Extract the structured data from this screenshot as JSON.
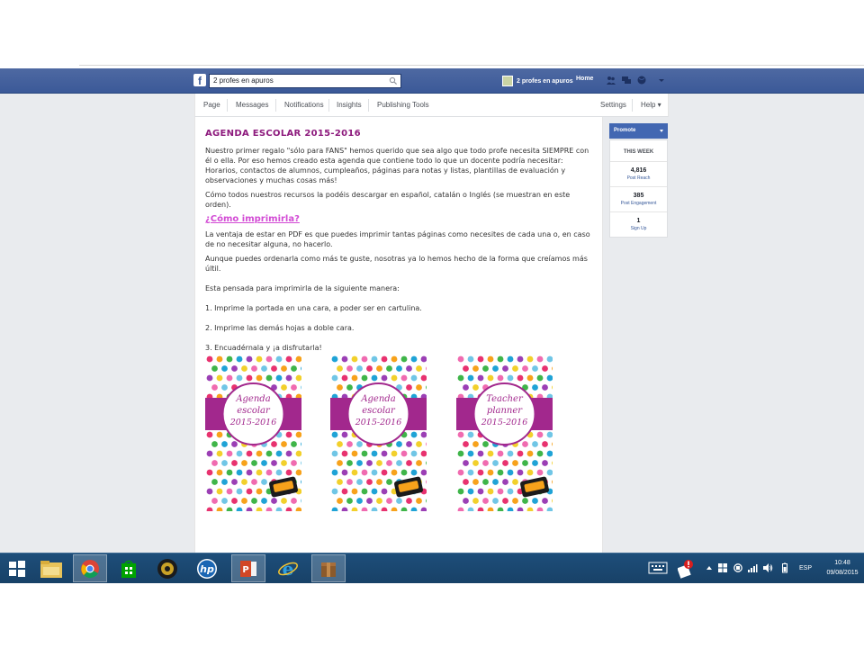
{
  "facebook": {
    "search_value": "2 profes en apuros",
    "profile_name": "2 profes en apuros",
    "home_label": "Home"
  },
  "page_nav": {
    "items": [
      "Page",
      "Messages",
      "Notifications",
      "Insights",
      "Publishing Tools"
    ],
    "settings": "Settings",
    "help": "Help ▾"
  },
  "post": {
    "title": "AGENDA ESCOLAR 2015-2016",
    "p1": "Nuestro primer regalo \"sólo para FANS\" hemos querido que sea algo que todo profe necesita SIEMPRE con él o ella. Por eso hemos creado esta agenda que contiene todo lo que un docente podría necesitar: Horarios, contactos de alumnos, cumpleaños, páginas para notas y listas, plantillas de evaluación y observaciones y muchas cosas más!",
    "p2": "Cómo todos nuestros recursos la podéis descargar en español, catalán o Inglés (se muestran en este orden).",
    "how_link": "¿Cómo imprimirla?",
    "p3": "La ventaja de estar en PDF es que puedes imprimir tantas páginas como necesites de cada una o, en caso de no necesitar alguna, no hacerlo.",
    "p4": "Aunque puedes ordenarla como más te guste, nosotras ya lo hemos hecho de la forma que creíamos más últil.",
    "p5": "Esta pensada para imprimirla de la siguiente manera:",
    "step1": "1. Imprime la portada en una cara, a poder ser en cartulina.",
    "step2": "2. Imprime las demás hojas a doble cara.",
    "step3": "3. Encuadérnala y ¡a disfrutarla!",
    "covers": [
      {
        "line1": "Agenda",
        "line2": "escolar",
        "line3": "2015-2016"
      },
      {
        "line1": "Agenda",
        "line2": "escolar",
        "line3": "2015-2016"
      },
      {
        "line1": "Teacher",
        "line2": "planner",
        "line3": "2015-2016"
      }
    ]
  },
  "sidebar": {
    "promote": "Promote",
    "this_week": "THIS WEEK",
    "stats": [
      {
        "value": "4,816",
        "label": "Post Reach"
      },
      {
        "value": "385",
        "label": "Post Engagement"
      },
      {
        "value": "1",
        "label": "Sign Up"
      }
    ]
  },
  "taskbar": {
    "language": "ESP",
    "time": "10:48",
    "date": "09/08/2015"
  },
  "colors": {
    "fb_blue": "#3b5998",
    "title_purple": "#8d1a7d",
    "link_pink": "#d24ad4",
    "cover_band": "#a2288d"
  }
}
